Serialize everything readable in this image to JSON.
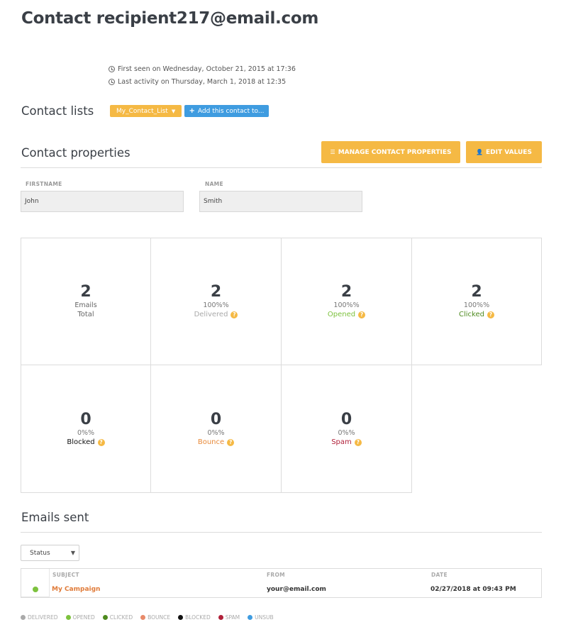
{
  "header": {
    "title": "Contact recipient217@email.com"
  },
  "meta": {
    "first_seen": "First seen on Wednesday, October 21, 2015 at 17:36",
    "last_activity": "Last activity on Thursday, March 1, 2018 at 12:35"
  },
  "contact_lists": {
    "heading": "Contact lists",
    "list_button": "My_Contact_List",
    "add_button": "Add this contact to..."
  },
  "contact_properties": {
    "heading": "Contact properties",
    "manage_button": "MANAGE CONTACT PROPERTIES",
    "edit_button": "EDIT VALUES",
    "fields": [
      {
        "label": "FIRSTNAME",
        "value": "John"
      },
      {
        "label": "NAME",
        "value": "Smith"
      }
    ]
  },
  "stats": [
    {
      "number": "2",
      "line1": "Emails",
      "line2": "Total",
      "color": "#666666",
      "help": false
    },
    {
      "number": "2",
      "line1": "100%%",
      "line2": "Delivered",
      "color": "#aaaaaa",
      "help": true
    },
    {
      "number": "2",
      "line1": "100%%",
      "line2": "Opened",
      "color": "#7dc23e",
      "help": true
    },
    {
      "number": "2",
      "line1": "100%%",
      "line2": "Clicked",
      "color": "#4e8a1e",
      "help": true
    },
    {
      "number": "0",
      "line1": "0%%",
      "line2": "Blocked",
      "color": "#111111",
      "help": true
    },
    {
      "number": "0",
      "line1": "0%%",
      "line2": "Bounce",
      "color": "#e88a3a",
      "help": true
    },
    {
      "number": "0",
      "line1": "0%%",
      "line2": "Spam",
      "color": "#b0213a",
      "help": true
    }
  ],
  "emails_sent": {
    "heading": "Emails sent",
    "status_select": "Status",
    "columns": {
      "subject": "SUBJECT",
      "from": "FROM",
      "date": "DATE"
    },
    "rows": [
      {
        "subject": "My Campaign",
        "from": "your@email.com",
        "date": "02/27/2018 at 09:43 PM",
        "status_color": "#7dc23e"
      }
    ]
  },
  "legend": [
    {
      "label": "DELIVERED",
      "color": "#aaaaaa"
    },
    {
      "label": "OPENED",
      "color": "#7dc23e"
    },
    {
      "label": "CLICKED",
      "color": "#4e8a1e"
    },
    {
      "label": "BOUNCE",
      "color": "#e88a6a"
    },
    {
      "label": "BLOCKED",
      "color": "#111111"
    },
    {
      "label": "SPAM",
      "color": "#b0213a"
    },
    {
      "label": "UNSUB",
      "color": "#3f9ce0"
    }
  ],
  "colors": {
    "accent_yellow": "#f5b944",
    "accent_blue": "#3f9ce0",
    "link_orange": "#e07b39"
  }
}
